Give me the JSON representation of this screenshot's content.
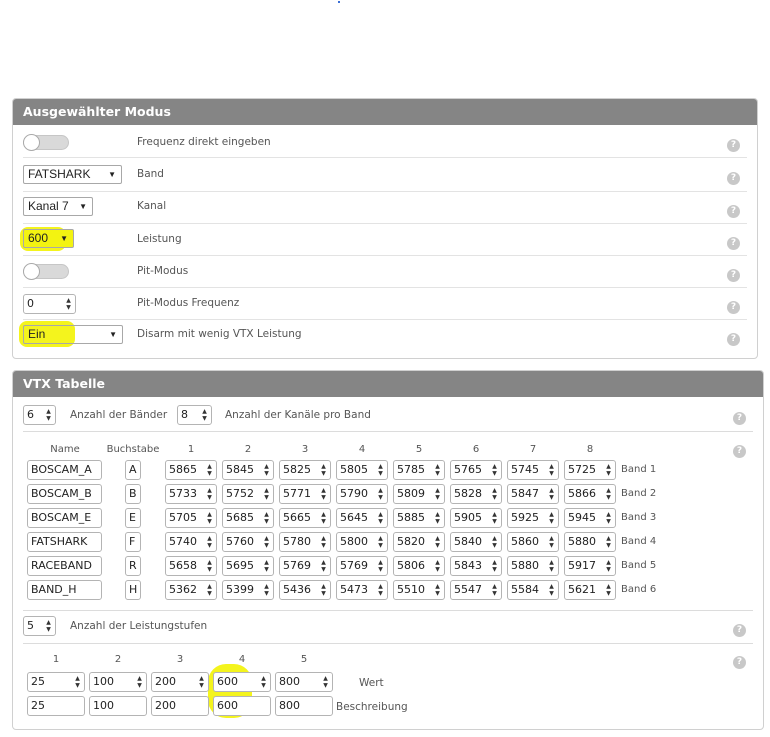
{
  "mode_panel": {
    "title": "Ausgewählter Modus",
    "rows": {
      "freq_direct": {
        "label": "Frequenz direkt eingeben"
      },
      "band": {
        "value": "FATSHARK",
        "label": "Band"
      },
      "channel": {
        "value": "Kanal 7",
        "label": "Kanal"
      },
      "power": {
        "value": "600",
        "label": "Leistung"
      },
      "pit_mode": {
        "label": "Pit-Modus"
      },
      "pit_freq": {
        "value": "0",
        "label": "Pit-Modus Frequenz"
      },
      "disarm": {
        "value": "Ein",
        "label": "Disarm mit wenig VTX Leistung"
      }
    },
    "help_glyph": "?"
  },
  "vtx_panel": {
    "title": "VTX Tabelle",
    "bands_count": "6",
    "bands_label": "Anzahl der Bänder",
    "channels_count": "8",
    "channels_label": "Anzahl der Kanäle pro Band",
    "headers": [
      "Name",
      "Buchstabe",
      "1",
      "2",
      "3",
      "4",
      "5",
      "6",
      "7",
      "8"
    ],
    "bands": [
      {
        "name": "BOSCAM_A",
        "letter": "A",
        "freqs": [
          "5865",
          "5845",
          "5825",
          "5805",
          "5785",
          "5765",
          "5745",
          "5725"
        ],
        "label": "Band 1"
      },
      {
        "name": "BOSCAM_B",
        "letter": "B",
        "freqs": [
          "5733",
          "5752",
          "5771",
          "5790",
          "5809",
          "5828",
          "5847",
          "5866"
        ],
        "label": "Band 2"
      },
      {
        "name": "BOSCAM_E",
        "letter": "E",
        "freqs": [
          "5705",
          "5685",
          "5665",
          "5645",
          "5885",
          "5905",
          "5925",
          "5945"
        ],
        "label": "Band 3"
      },
      {
        "name": "FATSHARK",
        "letter": "F",
        "freqs": [
          "5740",
          "5760",
          "5780",
          "5800",
          "5820",
          "5840",
          "5860",
          "5880"
        ],
        "label": "Band 4"
      },
      {
        "name": "RACEBAND",
        "letter": "R",
        "freqs": [
          "5658",
          "5695",
          "5769",
          "5769",
          "5806",
          "5843",
          "5880",
          "5917"
        ],
        "label": "Band 5"
      },
      {
        "name": "BAND_H",
        "letter": "H",
        "freqs": [
          "5362",
          "5399",
          "5436",
          "5473",
          "5510",
          "5547",
          "5584",
          "5621"
        ],
        "label": "Band 6"
      }
    ],
    "power_levels_count": "5",
    "power_levels_label": "Anzahl der Leistungstufen",
    "power_headers": [
      "1",
      "2",
      "3",
      "4",
      "5"
    ],
    "power_values": [
      "25",
      "100",
      "200",
      "600",
      "800"
    ],
    "power_values_label": "Wert",
    "power_desc": [
      "25",
      "100",
      "200",
      "600",
      "800"
    ],
    "power_desc_label": "Beschreibung"
  },
  "colors": {
    "header_bg": "#858585",
    "highlight": "#f3f311"
  }
}
